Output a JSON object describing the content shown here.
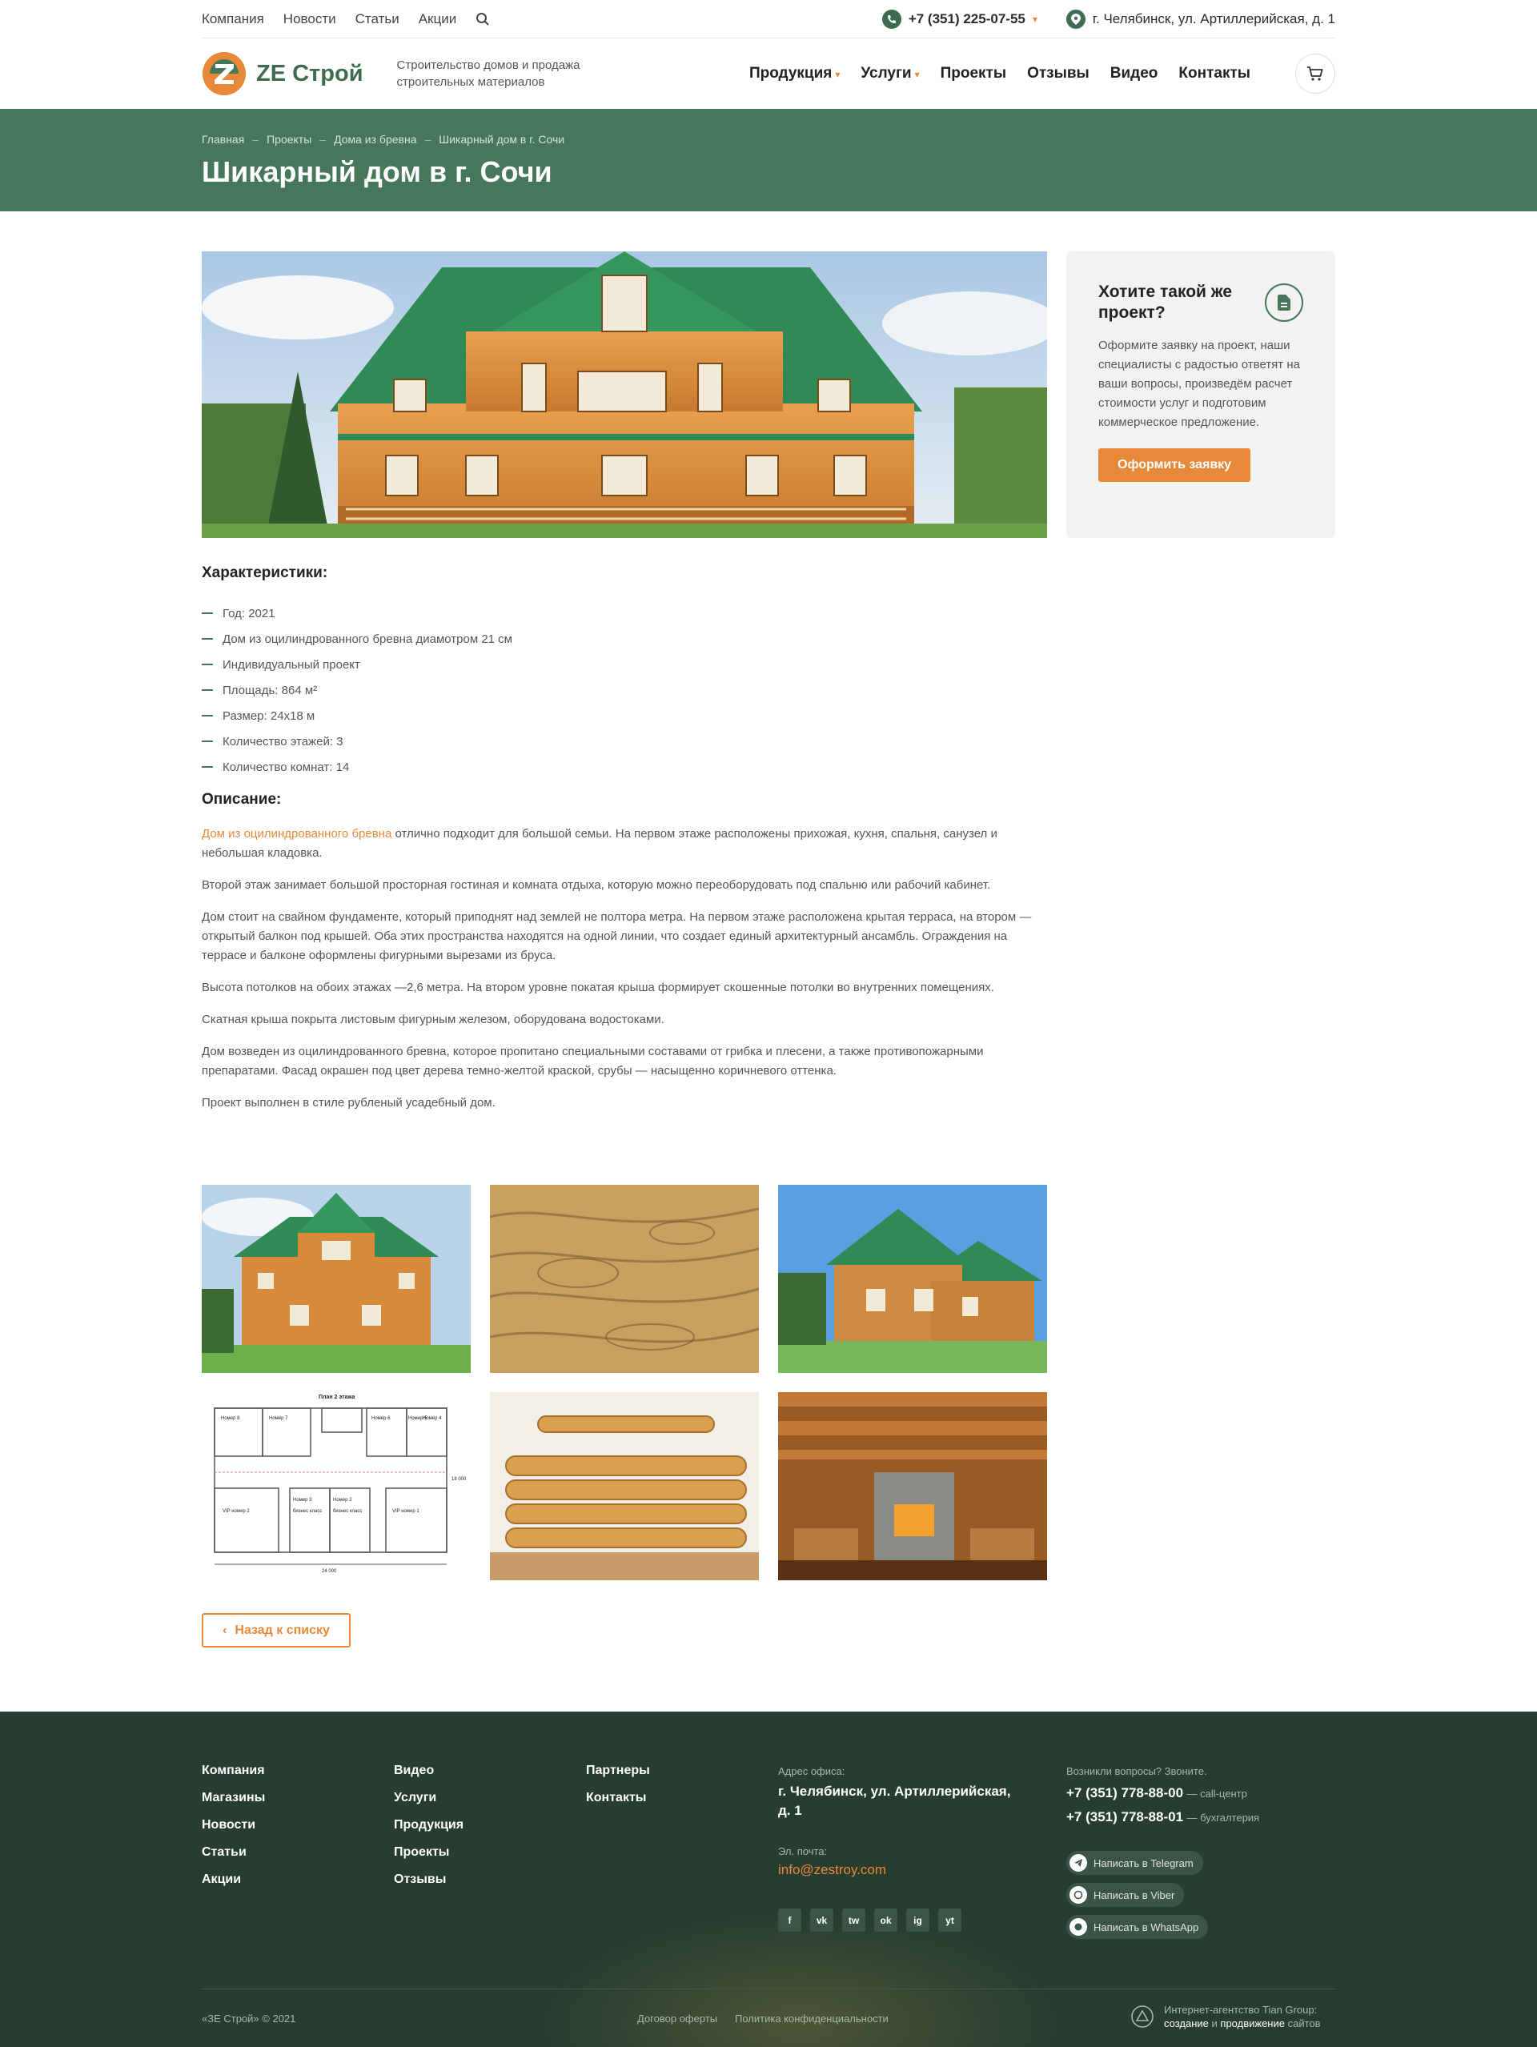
{
  "topbar": {
    "nav": [
      "Компания",
      "Новости",
      "Статьи",
      "Акции"
    ],
    "phone": "+7 (351) 225-07-55",
    "address": "г. Челябинск, ул. Артиллерийская, д. 1"
  },
  "header": {
    "logo_text": "ZE Строй",
    "tagline": "Строительство домов и продажа строительных материалов",
    "nav": [
      "Продукция",
      "Услуги",
      "Проекты",
      "Отзывы",
      "Видео",
      "Контакты"
    ]
  },
  "hero": {
    "breadcrumb": [
      "Главная",
      "Проекты",
      "Дома из бревна",
      "Шикарный дом в г. Сочи"
    ],
    "title": "Шикарный дом в г. Сочи"
  },
  "cta": {
    "title": "Хотите такой же проект?",
    "text": "Оформите заявку на проект, наши специалисты с радостью ответят на ваши вопросы, произведём расчет стоимости услуг и подготовим коммерческое предложение.",
    "button": "Оформить заявку"
  },
  "characteristics": {
    "heading": "Характеристики:",
    "items": [
      "Год: 2021",
      "Дом из оцилиндрованного бревна диамотром 21 см",
      "Индивидуальный проект",
      "Площадь: 864 м²",
      "Размер: 24x18 м",
      "Количество этажей: 3",
      "Количество комнат: 14"
    ]
  },
  "description": {
    "heading": "Описание:",
    "link": "Дом из оцилиндрованного бревна",
    "p1_rest": " отлично подходит для большой семьи. На первом этаже расположены прихожая, кухня, спальня, санузел и небольшая кладовка.",
    "paragraphs": [
      "Второй этаж занимает большой просторная гостиная и комната отдыха, которую можно переоборудовать под спальню или рабочий кабинет.",
      "Дом стоит на свайном фундаменте, который приподнят над землей не полтора метра. На первом этаже расположена крытая терраса, на втором — открытый балкон под крышей. Оба этих пространства находятся на одной линии, что создает единый архитектурный ансамбль. Ограждения на террасе и балконе оформлены фигурными вырезами из бруса.",
      "Высота потолков на обоих этажах —2,6 метра. На втором уровне покатая крыша формирует скошенные потолки во внутренних помещениях.",
      "Скатная крыша покрыта листовым фигурным железом, оборудована водостоками.",
      "Дом возведен из оцилиндрованного бревна, которое пропитано специальными составами от грибка и плесени, а также противопожарными препаратами. Фасад окрашен под цвет дерева темно-желтой краской, срубы — насыщенно коричневого оттенка.",
      "Проект выполнен в стиле рубленый усадебный дом."
    ]
  },
  "floorplan": {
    "title": "План 2 этажа",
    "rooms": [
      "Номер 8",
      "Номер 7",
      "Номер 6",
      "Номер 5",
      "Номер 4",
      "Номер 3",
      "Номер 2",
      "VIP номер 2",
      "VIP номер 1",
      "бизнес класс",
      "бизнес класс"
    ],
    "width_label": "24 000",
    "height_label": "18 000"
  },
  "back_button": "Назад к списку",
  "footer": {
    "col1": [
      "Компания",
      "Магазины",
      "Новости",
      "Статьи",
      "Акции"
    ],
    "col2": [
      "Видео",
      "Услуги",
      "Продукция",
      "Проекты",
      "Отзывы"
    ],
    "col3": [
      "Партнеры",
      "Контакты"
    ],
    "address_label": "Адрес офиса:",
    "address": "г. Челябинск, ул. Артиллерийская, д. 1",
    "email_label": "Эл. почта:",
    "email": "info@zestroy.com",
    "questions_label": "Возникли вопросы? Звоните.",
    "phone1": "+7 (351) 778-88-00",
    "phone1_note": "— call-центр",
    "phone2": "+7 (351) 778-88-01",
    "phone2_note": "— бухгалтерия",
    "messengers": [
      "Написать в Telegram",
      "Написать в Viber",
      "Написать в WhatsApp"
    ],
    "socials": [
      "f",
      "vk",
      "tw",
      "ok",
      "ig",
      "yt"
    ],
    "copyright": "«ЗЕ Строй» © 2021",
    "offer": "Договор оферты",
    "privacy": "Политика конфиденциальности",
    "agency_line1": "Интернет-агентство Tian Group:",
    "agency_line2_a": "создание",
    "agency_line2_b": " и ",
    "agency_line2_c": "продвижение",
    "agency_line2_d": " сайтов"
  },
  "colors": {
    "green": "#46775a",
    "dark_green": "#263d30",
    "orange": "#e8893a"
  }
}
